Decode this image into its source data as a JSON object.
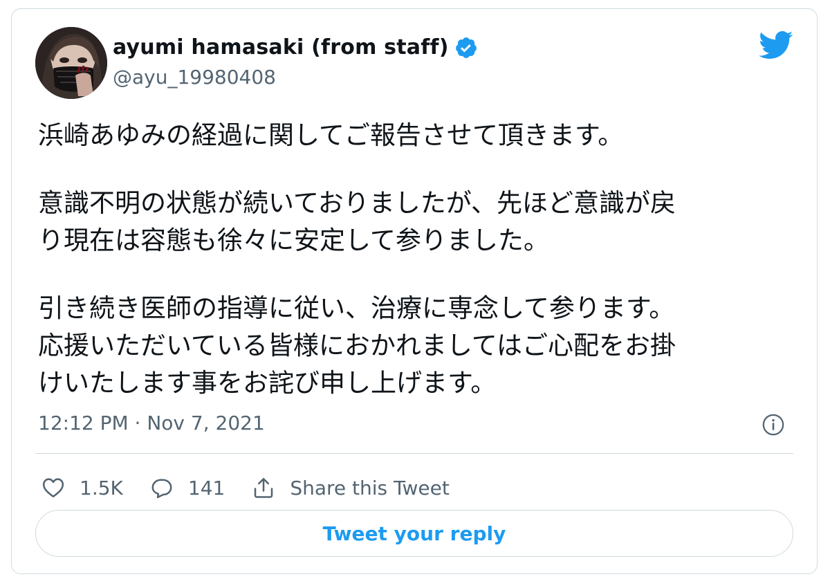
{
  "author": {
    "display_name": "ayumi hamasaki (from staff)",
    "handle": "@ayu_19980408",
    "verified": true,
    "avatar_icon": "profile-photo"
  },
  "tweet": {
    "paragraphs": [
      [
        "浜崎あゆみの経過に関してご報告させて頂きます。"
      ],
      [
        "意識不明の状態が続いておりましたが、先ほど意識が戻",
        "り現在は容態も徐々に安定して参りました。"
      ],
      [
        "引き続き医師の指導に従い、治療に専念して参ります。",
        "応援いただいている皆様におかれましてはご心配をお掛",
        "けいたします事をお詫び申し上げます。"
      ]
    ],
    "timestamp": "12:12 PM · Nov 7, 2021"
  },
  "actions": {
    "likes": "1.5K",
    "replies": "141",
    "share_label": "Share this Tweet"
  },
  "reply_button": {
    "label": "Tweet your reply"
  },
  "icons": {
    "brand": "twitter-bird-icon",
    "verified": "verified-badge-icon",
    "info": "info-icon",
    "like": "heart-icon",
    "reply": "speech-bubble-icon",
    "share": "share-icon"
  },
  "colors": {
    "brand_blue": "#1d9bf0",
    "text_primary": "#0f1419",
    "text_secondary": "#536471",
    "border": "#cfd9de"
  }
}
